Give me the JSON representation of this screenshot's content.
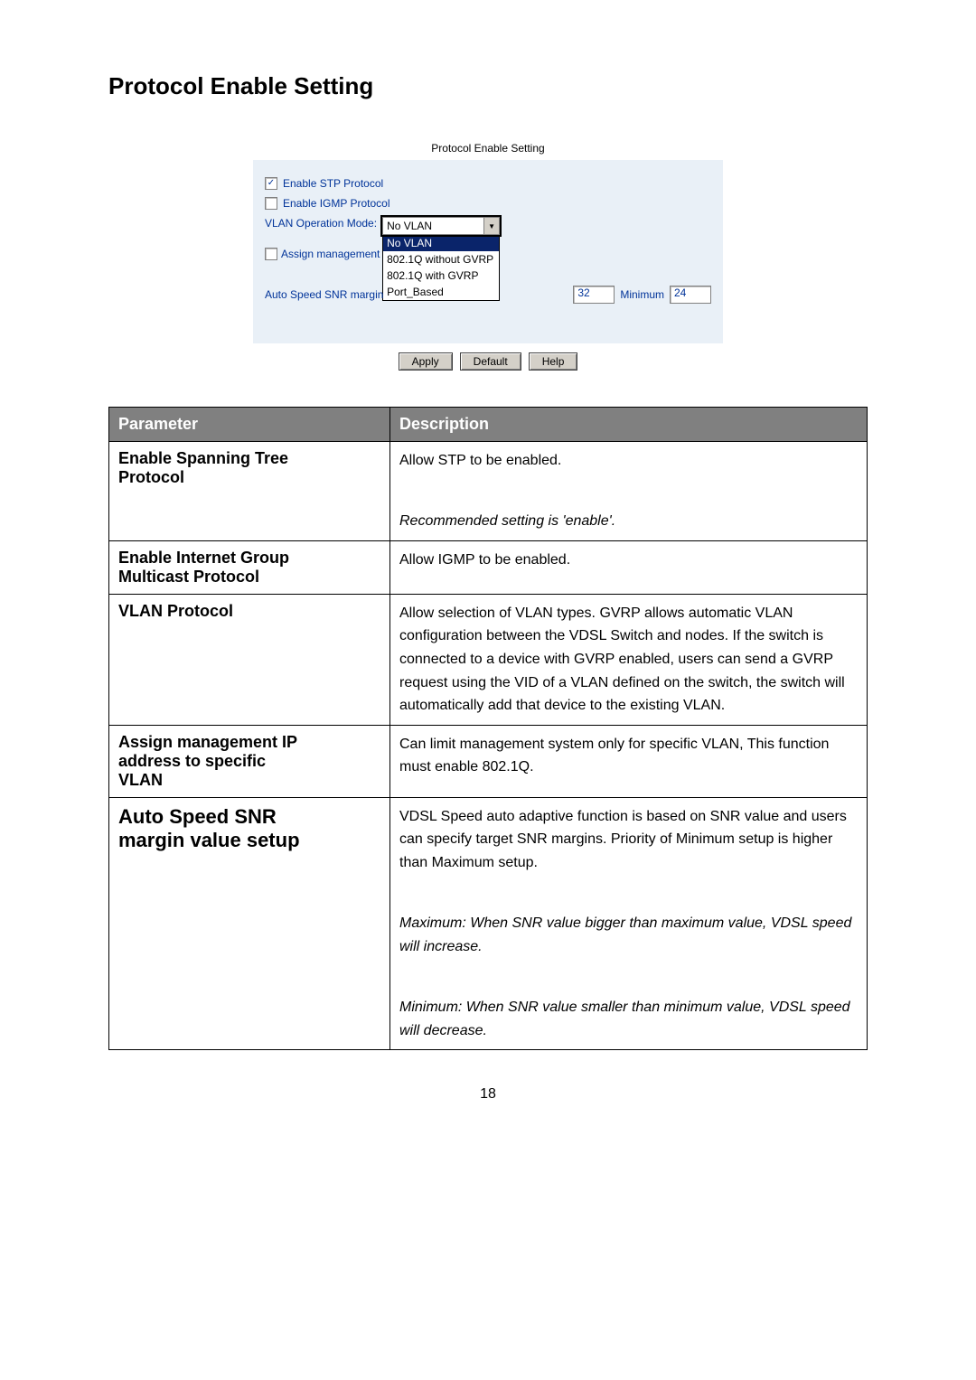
{
  "page_title": "Protocol Enable Setting",
  "screenshot": {
    "caption": "Protocol Enable Setting",
    "enable_stp": {
      "label": "Enable STP Protocol",
      "checked": "✓"
    },
    "enable_igmp": {
      "label": "Enable IGMP Protocol",
      "checked": ""
    },
    "vlan_mode": {
      "label": "VLAN Operation Mode:",
      "value": "No VLAN",
      "options": [
        "No VLAN",
        "802.1Q without GVRP",
        "802.1Q with GVRP",
        "Port_Based"
      ]
    },
    "assign_mgmt": {
      "label": "Assign management"
    },
    "snr_margin": {
      "label_prefix": "Auto Speed SNR margin",
      "max_value": "32",
      "min_label": "Minimum",
      "min_value": "24"
    },
    "buttons": {
      "apply": "Apply",
      "default": "Default",
      "help": "Help"
    }
  },
  "table": {
    "headers": {
      "param": "Parameter",
      "desc": "Description"
    },
    "rows": {
      "stp": {
        "label1": "Enable Spanning Tree",
        "label2": "Protocol",
        "desc1": "Allow STP to be enabled.",
        "desc2": "Recommended setting is 'enable'."
      },
      "igmp": {
        "label1": "Enable Internet Group",
        "label2": "Multicast Protocol",
        "desc1": "Allow IGMP to be enabled."
      },
      "vlan": {
        "label1": "VLAN Protocol",
        "desc1": "Allow selection of VLAN types. GVRP allows automatic VLAN configuration between the VDSL Switch and nodes. If the switch is connected to a device with GVRP enabled, users can send a GVRP request using the VID of a VLAN defined on the switch, the switch will automatically add that device to the existing VLAN."
      },
      "assign": {
        "label1": "Assign management IP",
        "label2": "address to specific",
        "label3": "VLAN",
        "desc1": "Can limit management system only for specific VLAN, This function must enable 802.1Q."
      },
      "snr": {
        "label1": "Auto Speed SNR",
        "label2": "margin value setup",
        "desc1": "VDSL Speed auto adaptive function is based on SNR value and users can specify target SNR margins. Priority of Minimum setup is higher than Maximum setup.",
        "desc2": "Maximum: When SNR value bigger than maximum value, VDSL speed will increase.",
        "desc3": "Minimum: When SNR value smaller than minimum value, VDSL speed will decrease."
      }
    }
  },
  "page_number": "18"
}
